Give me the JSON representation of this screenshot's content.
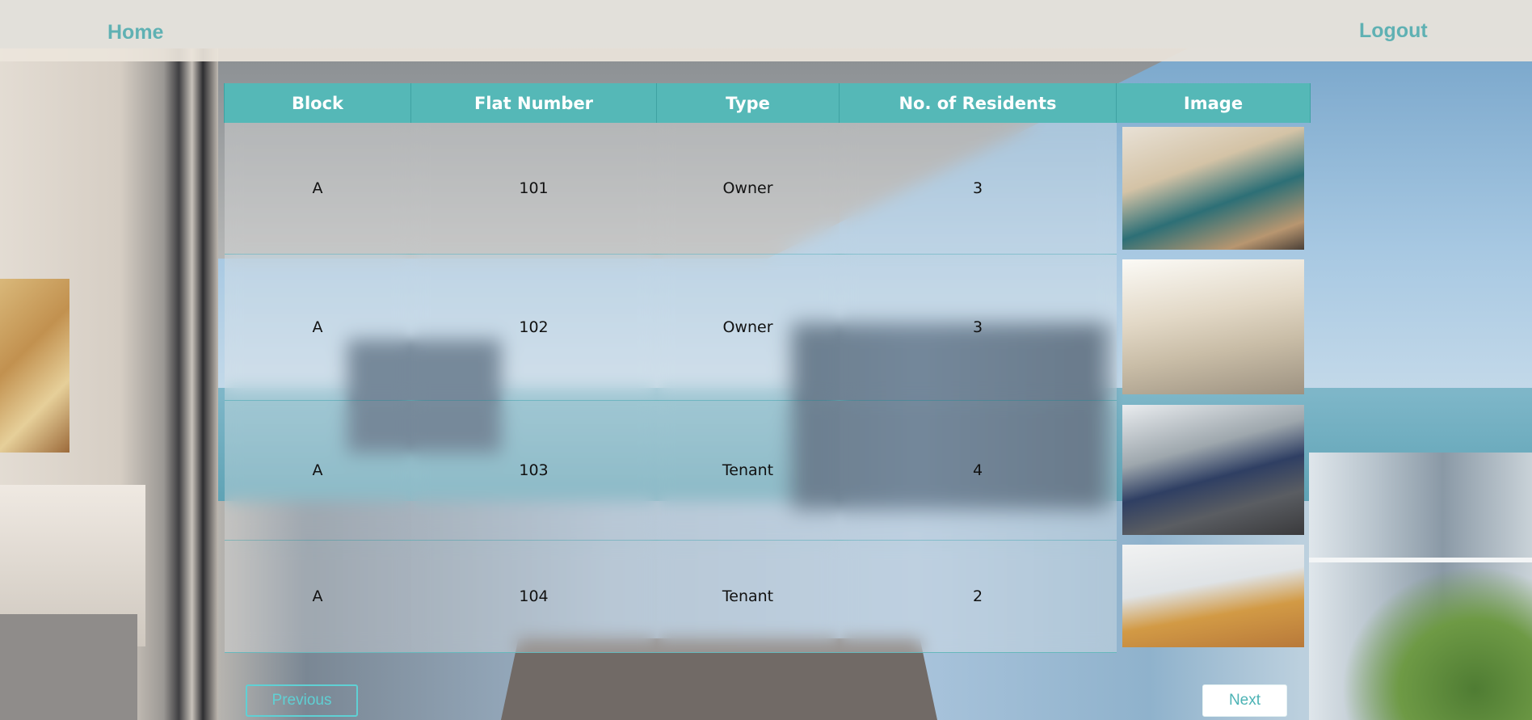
{
  "nav": {
    "home_label": "Home",
    "logout_label": "Logout",
    "link_color": "#5fb1b3"
  },
  "table": {
    "header_color": "#55b8b7",
    "columns": [
      "Block",
      "Flat Number",
      "Type",
      "No. of Residents",
      "Image"
    ],
    "rows": [
      {
        "block": "A",
        "flat": "101",
        "type": "Owner",
        "residents": "3",
        "image": "living-room-teal-sofa"
      },
      {
        "block": "A",
        "flat": "102",
        "type": "Owner",
        "residents": "3",
        "image": "living-room-beige"
      },
      {
        "block": "A",
        "flat": "103",
        "type": "Tenant",
        "residents": "4",
        "image": "living-room-blue-sofa"
      },
      {
        "block": "A",
        "flat": "104",
        "type": "Tenant",
        "residents": "2",
        "image": "dining-living-room"
      }
    ]
  },
  "pagination": {
    "previous_label": "Previous",
    "next_label": "Next"
  }
}
